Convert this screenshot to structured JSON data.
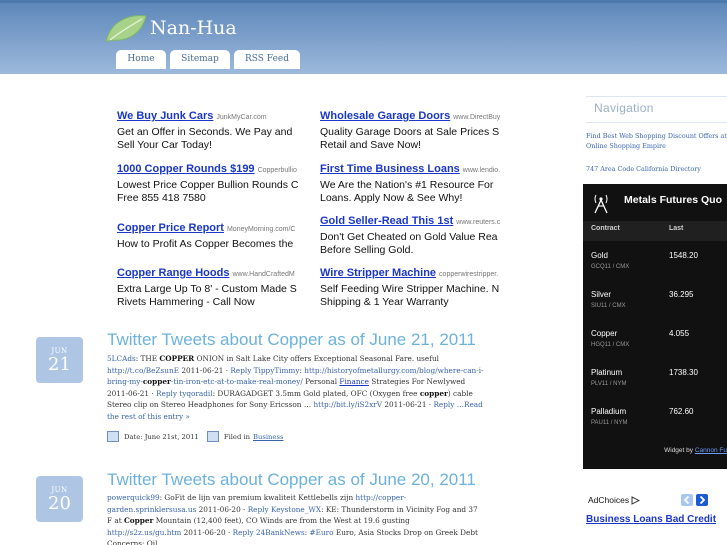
{
  "site": {
    "title": "Nan-Hua",
    "nav": [
      "Home",
      "Sitemap",
      "RSS Feed"
    ]
  },
  "ads": [
    {
      "title": "We Buy Junk Cars",
      "url": "JunkMyCar.com",
      "desc": "Get an Offer in Seconds. We Pay and Sell Your Car Today!"
    },
    {
      "title": "Wholesale Garage Doors",
      "url": "www.DirectBuy",
      "desc": "Quality Garage Doors at Sale Prices S Retail and Save Now!"
    },
    {
      "title": "1000 Copper Rounds $199",
      "url": "Copperbullio",
      "desc": "Lowest Price Copper Bullion Rounds C Free 855 418 7580"
    },
    {
      "title": "First Time Business Loans",
      "url": "www.lendio.",
      "desc": "We Are the Nation's #1 Resource For Loans. Apply Now & See Why!"
    },
    {
      "title": "Copper Price Report",
      "url": "MoneyMorning.com/C",
      "desc": "How to Profit As Copper Becomes the"
    },
    {
      "title": "Gold Seller-Read This 1st",
      "url": "www.reuters.c",
      "desc": "Don't Get Cheated on Gold Value Rea Before Selling Gold."
    },
    {
      "title": "Copper Range Hoods",
      "url": "www.HandCraftedM",
      "desc": "Extra Large Up To 8' - Custom Made S Rivets Hammering - Call Now"
    },
    {
      "title": "Wire Stripper Machine",
      "url": "copperwirestripper.",
      "desc": "Self Feeding Wire Stripper Machine. N Shipping & 1 Year Warranty"
    }
  ],
  "posts": [
    {
      "month": "JUN",
      "day": "21",
      "title": "Twitter Tweets about Copper as of June 21, 2011",
      "body": [
        {
          "t": "5LCAds",
          "k": "link"
        },
        {
          "t": ": THE ",
          "k": "text"
        },
        {
          "t": "COPPER",
          "k": "bold"
        },
        {
          "t": " ONION in Salt Lake City offers Exceptional Seasonal Fare. useful ",
          "k": "text"
        },
        {
          "t": "http://t.co/BeZsunE",
          "k": "link"
        },
        {
          "t": " 2011-06-21 · ",
          "k": "text"
        },
        {
          "t": "Reply TippyTimmy",
          "k": "link"
        },
        {
          "t": ": ",
          "k": "text"
        },
        {
          "t": "http://historyofmetallurgy.com/blog/where-can-i-bring-my-",
          "k": "link"
        },
        {
          "t": "copper",
          "k": "bold"
        },
        {
          "t": "-tin-iron-etc-at-to-make-real-money/",
          "k": "link"
        },
        {
          "t": " Personal ",
          "k": "text"
        },
        {
          "t": "Finance",
          "k": "ulink"
        },
        {
          "t": " Strategies For Newlywed 2011-06-21 · ",
          "k": "text"
        },
        {
          "t": "Reply tyqoradil",
          "k": "link"
        },
        {
          "t": ": DURAGADGET 3.5mm Gold plated, OFC (Oxygen free ",
          "k": "text"
        },
        {
          "t": "copper",
          "k": "bold"
        },
        {
          "t": ") cable Stereo clip on Stereo Headphones for Sony Ericsson … ",
          "k": "text"
        },
        {
          "t": "http://bit.ly/iS2xrV",
          "k": "link"
        },
        {
          "t": " 2011-06-21 · ",
          "k": "text"
        },
        {
          "t": "Reply …Read the rest of this entry »",
          "k": "link"
        }
      ],
      "date_label": "Date: June 21st, 2011",
      "filed_label": "Filed in",
      "category": "Business"
    },
    {
      "month": "JUN",
      "day": "20",
      "title": "Twitter Tweets about Copper as of June 20, 2011",
      "body": [
        {
          "t": "powerquick99",
          "k": "link"
        },
        {
          "t": ": GoFit de lijn van premium kwaliteit Kettlebells zijn ",
          "k": "text"
        },
        {
          "t": "http://copper-garden.sprinklersusa.us",
          "k": "link"
        },
        {
          "t": " 2011-06-20 · ",
          "k": "text"
        },
        {
          "t": "Reply Keystone_WX",
          "k": "link"
        },
        {
          "t": ": KE: Thunderstorm in Vicinity Fog and 37 F at ",
          "k": "text"
        },
        {
          "t": "Copper",
          "k": "bold"
        },
        {
          "t": " Mountain (12,400 feet), CO Winds are from the West at 19.6 gusting ",
          "k": "text"
        },
        {
          "t": "http://s2z.us/gu.htm",
          "k": "link"
        },
        {
          "t": " 2011-06-20 · ",
          "k": "text"
        },
        {
          "t": "Reply 24BankNews",
          "k": "link"
        },
        {
          "t": ": ",
          "k": "text"
        },
        {
          "t": "#Euro",
          "k": "link"
        },
        {
          "t": " Euro, Asia Stocks Drop on Greek Debt Concerns; Oil,",
          "k": "text"
        }
      ]
    }
  ],
  "sidebar": {
    "navigation_heading": "Navigation",
    "links": [
      "Find Best Web Shopping Discount Offers at Online Shopping Empire",
      "747 Area Code California Directory"
    ],
    "metals_widget": {
      "title": "Metals Futures Quo",
      "col_contract": "Contract",
      "col_last": "Last",
      "rows": [
        {
          "name": "Gold",
          "symbol": "GCQ11 / CMX",
          "last": "1548.20"
        },
        {
          "name": "Silver",
          "symbol": "SIU11 / CMX",
          "last": "36.295"
        },
        {
          "name": "Copper",
          "symbol": "HGQ11 / CMX",
          "last": "4.055"
        },
        {
          "name": "Platinum",
          "symbol": "PLV11 / NYM",
          "last": "1738.30"
        },
        {
          "name": "Palladium",
          "symbol": "PAU11 / NYM",
          "last": "762.60"
        }
      ],
      "footer_prefix": "Widget by",
      "footer_link": "Cannon Fu"
    },
    "adchoices_label": "AdChoices",
    "side_ad_title": "Business Loans Bad Credit"
  },
  "colors": {
    "header": "#7fa2cc",
    "post_title": "#6cb2dc",
    "ad_title": "#1a37c8",
    "widget_bg": "#111111"
  }
}
